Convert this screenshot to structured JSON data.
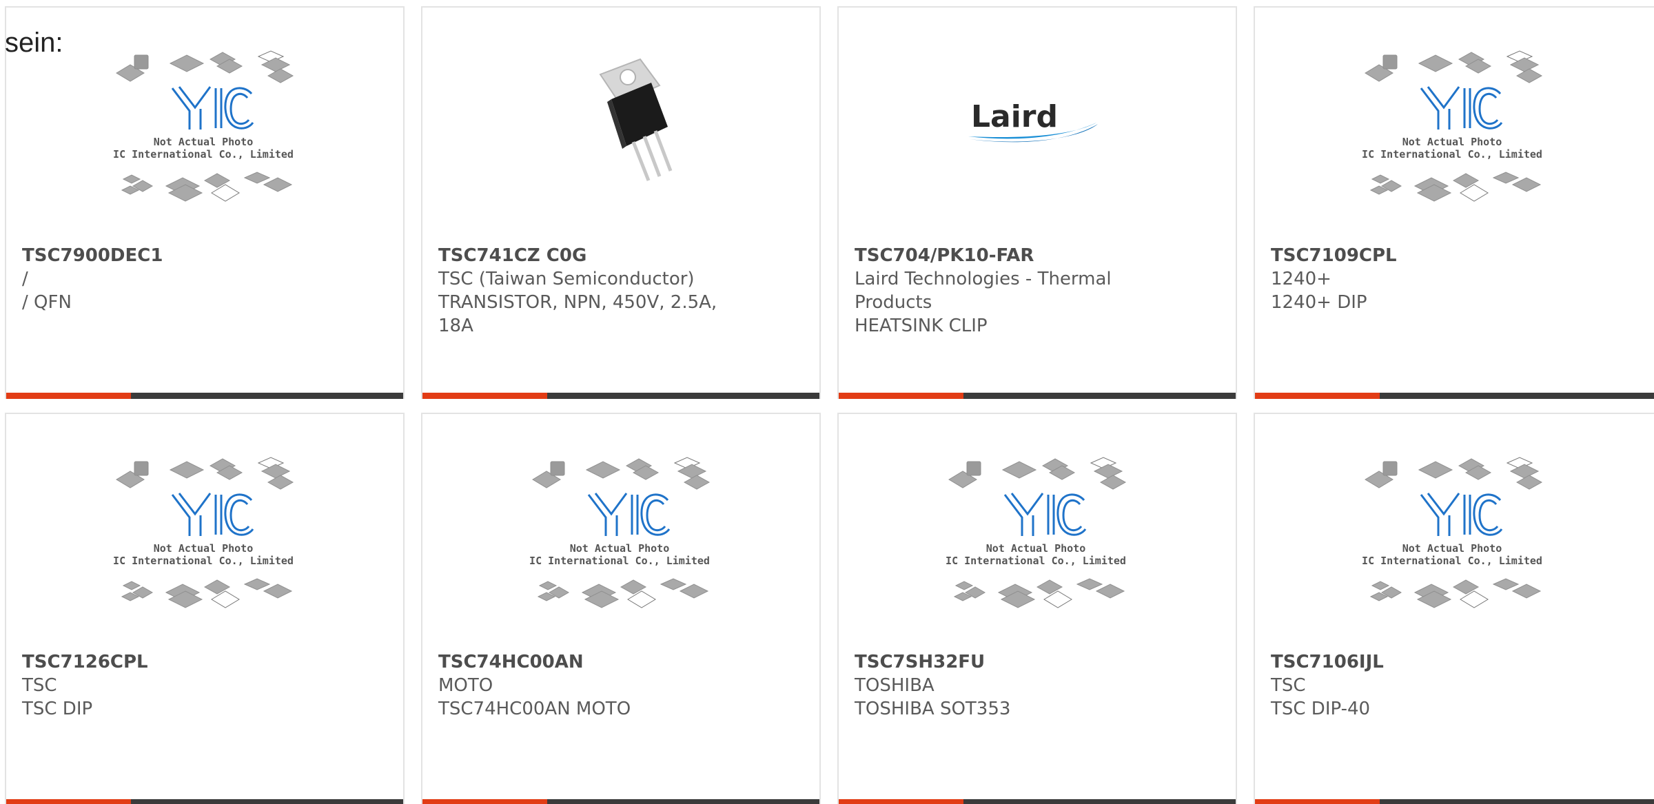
{
  "top_label": "sein:",
  "placeholder_text": {
    "line1": "Not Actual Photo",
    "line2": "YIC International Co., Limited.",
    "logo": "YIC"
  },
  "brand_logo_text": "Laird",
  "colors": {
    "accent": "#e23c15",
    "bar": "#3b3b3b",
    "yic_blue": "#1f73c9"
  },
  "products": [
    {
      "part_number": "TSC7900DEC1",
      "manufacturer": "/",
      "description": "/ QFN",
      "image": "yic-placeholder"
    },
    {
      "part_number": "TSC741CZ C0G",
      "manufacturer": "TSC (Taiwan Semiconductor)",
      "description": "TRANSISTOR, NPN, 450V, 2.5A, 18A",
      "image": "to220-transistor"
    },
    {
      "part_number": "TSC704/PK10-FAR",
      "manufacturer": "Laird Technologies - Thermal Products",
      "description": "HEATSINK CLIP",
      "image": "laird-logo"
    },
    {
      "part_number": "TSC7109CPL",
      "manufacturer": "1240+",
      "description": "1240+ DIP",
      "image": "yic-placeholder"
    },
    {
      "part_number": "TSC7126CPL",
      "manufacturer": "TSC",
      "description": "TSC DIP",
      "image": "yic-placeholder"
    },
    {
      "part_number": "TSC74HC00AN",
      "manufacturer": "MOTO",
      "description": "TSC74HC00AN MOTO",
      "image": "yic-placeholder"
    },
    {
      "part_number": "TSC7SH32FU",
      "manufacturer": "TOSHIBA",
      "description": "TOSHIBA SOT353",
      "image": "yic-placeholder"
    },
    {
      "part_number": "TSC7106IJL",
      "manufacturer": "TSC",
      "description": "TSC DIP-40",
      "image": "yic-placeholder"
    }
  ]
}
